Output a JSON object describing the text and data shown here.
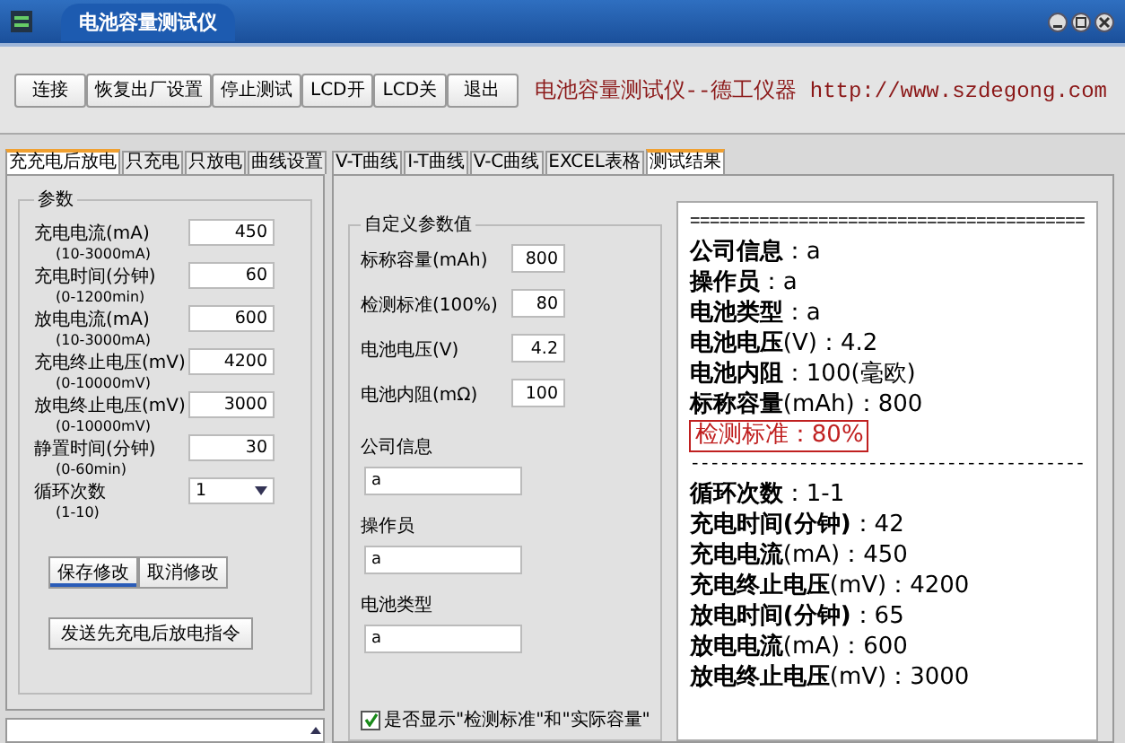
{
  "window": {
    "title": "电池容量测试仪"
  },
  "toolbar": {
    "buttons": [
      "连接",
      "恢复出厂设置",
      "停止测试",
      "LCD开",
      "LCD关",
      "退出"
    ],
    "brand": "电池容量测试仪--德工仪器 http://www.szdegong.com"
  },
  "left_panel": {
    "tabs": [
      {
        "label": "充充电后放电",
        "selected": true
      },
      {
        "label": "只充电",
        "selected": false
      },
      {
        "label": "只放电",
        "selected": false
      },
      {
        "label": "曲线设置",
        "selected": false
      }
    ],
    "group_title": "参数",
    "params": [
      {
        "kind": "input",
        "label": "充电电流(mA)",
        "range": "(10-3000mA)",
        "value": "450"
      },
      {
        "kind": "input",
        "label": "充电时间(分钟)",
        "range": "(0-1200min)",
        "value": "60"
      },
      {
        "kind": "input",
        "label": "放电电流(mA)",
        "range": "(10-3000mA)",
        "value": "600"
      },
      {
        "kind": "input",
        "label": "充电终止电压(mV)",
        "range": "(0-10000mV)",
        "value": "4200"
      },
      {
        "kind": "input",
        "label": "放电终止电压(mV)",
        "range": "(0-10000mV)",
        "value": "3000"
      },
      {
        "kind": "input",
        "label": "静置时间(分钟)",
        "range": "(0-60min)",
        "value": "30"
      },
      {
        "kind": "select",
        "label": "循环次数",
        "range": "(1-10)",
        "value": "1"
      }
    ],
    "buttons": [
      {
        "label": "保存修改",
        "focused": true
      },
      {
        "label": "取消修改",
        "focused": false
      }
    ],
    "send_button": "发送先充电后放电指令"
  },
  "right_panel": {
    "tabs": [
      {
        "label": "V-T曲线",
        "selected": false
      },
      {
        "label": "I-T曲线",
        "selected": false
      },
      {
        "label": "V-C曲线",
        "selected": false
      },
      {
        "label": "EXCEL表格",
        "selected": false
      },
      {
        "label": "测试结果",
        "selected": true
      }
    ],
    "form": {
      "group_title": "自定义参数值",
      "fields": [
        {
          "label": "标称容量(mAh)",
          "value": "800"
        },
        {
          "label": "检测标准(100%)",
          "value": "80"
        },
        {
          "label": "电池电压(V)",
          "value": "4.2"
        },
        {
          "label": "电池内阻(mΩ)",
          "value": "100"
        }
      ],
      "text_fields": [
        {
          "label": "公司信息",
          "value": "a"
        },
        {
          "label": "操作员",
          "value": "a"
        },
        {
          "label": "电池类型",
          "value": "a"
        }
      ],
      "checkbox": {
        "label": "是否显示\"检测标准\"和\"实际容量\"",
        "checked": true
      }
    },
    "results": [
      {
        "kind": "rule",
        "text": "========================================"
      },
      {
        "kind": "line",
        "text": "**公司信息**：a"
      },
      {
        "kind": "line",
        "text": "**操作员**：a"
      },
      {
        "kind": "line",
        "text": "**电池类型**：a"
      },
      {
        "kind": "line",
        "text": "**电池电压**(V)：4.2"
      },
      {
        "kind": "line",
        "text": "**电池内阻**：100(毫欧)"
      },
      {
        "kind": "line",
        "text": "**标称容量**(mAh)：800"
      },
      {
        "kind": "highlight",
        "text": "检测标准：80%"
      },
      {
        "kind": "rule",
        "text": "----------------------------------------"
      },
      {
        "kind": "line",
        "text": "**循环次数**：1-1"
      },
      {
        "kind": "line",
        "text": "**充电时间(分钟)**：42"
      },
      {
        "kind": "line",
        "text": "**充电电流**(mA)：450"
      },
      {
        "kind": "line",
        "text": "**充电终止电压**(mV)：4200"
      },
      {
        "kind": "line",
        "text": "**放电时间(分钟)**：65"
      },
      {
        "kind": "line",
        "text": "**放电电流**(mA)：600"
      },
      {
        "kind": "line",
        "text": "**放电终止电压**(mV)：3000"
      }
    ]
  }
}
